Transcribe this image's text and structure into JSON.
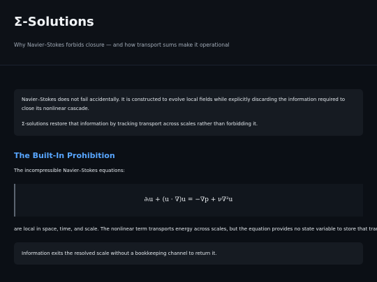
{
  "header": {
    "title": "Σ-Solutions",
    "subtitle": "Why Navier–Stokes forbids closure — and how transport sums make it operational"
  },
  "intro": {
    "paragraph_1": "Navier–Stokes does not fail accidentally. It is constructed to evolve local fields while explicitly discarding the information required to close its nonlinear cascade.",
    "paragraph_2": "Σ-solutions restore that information by tracking transport across scales rather than forbidding it."
  },
  "section": {
    "title": "The Built-In Prohibition",
    "lead": "The incompressible Navier–Stokes equations:",
    "equation": "∂ₜu + (u · ∇)u = −∇p + ν∇²u",
    "body": "are local in space, time, and scale. The nonlinear term transports energy across scales, but the equation provides no state variable to store that transport.",
    "note": "Information exits the resolved scale without a bookkeeping channel to return it."
  }
}
